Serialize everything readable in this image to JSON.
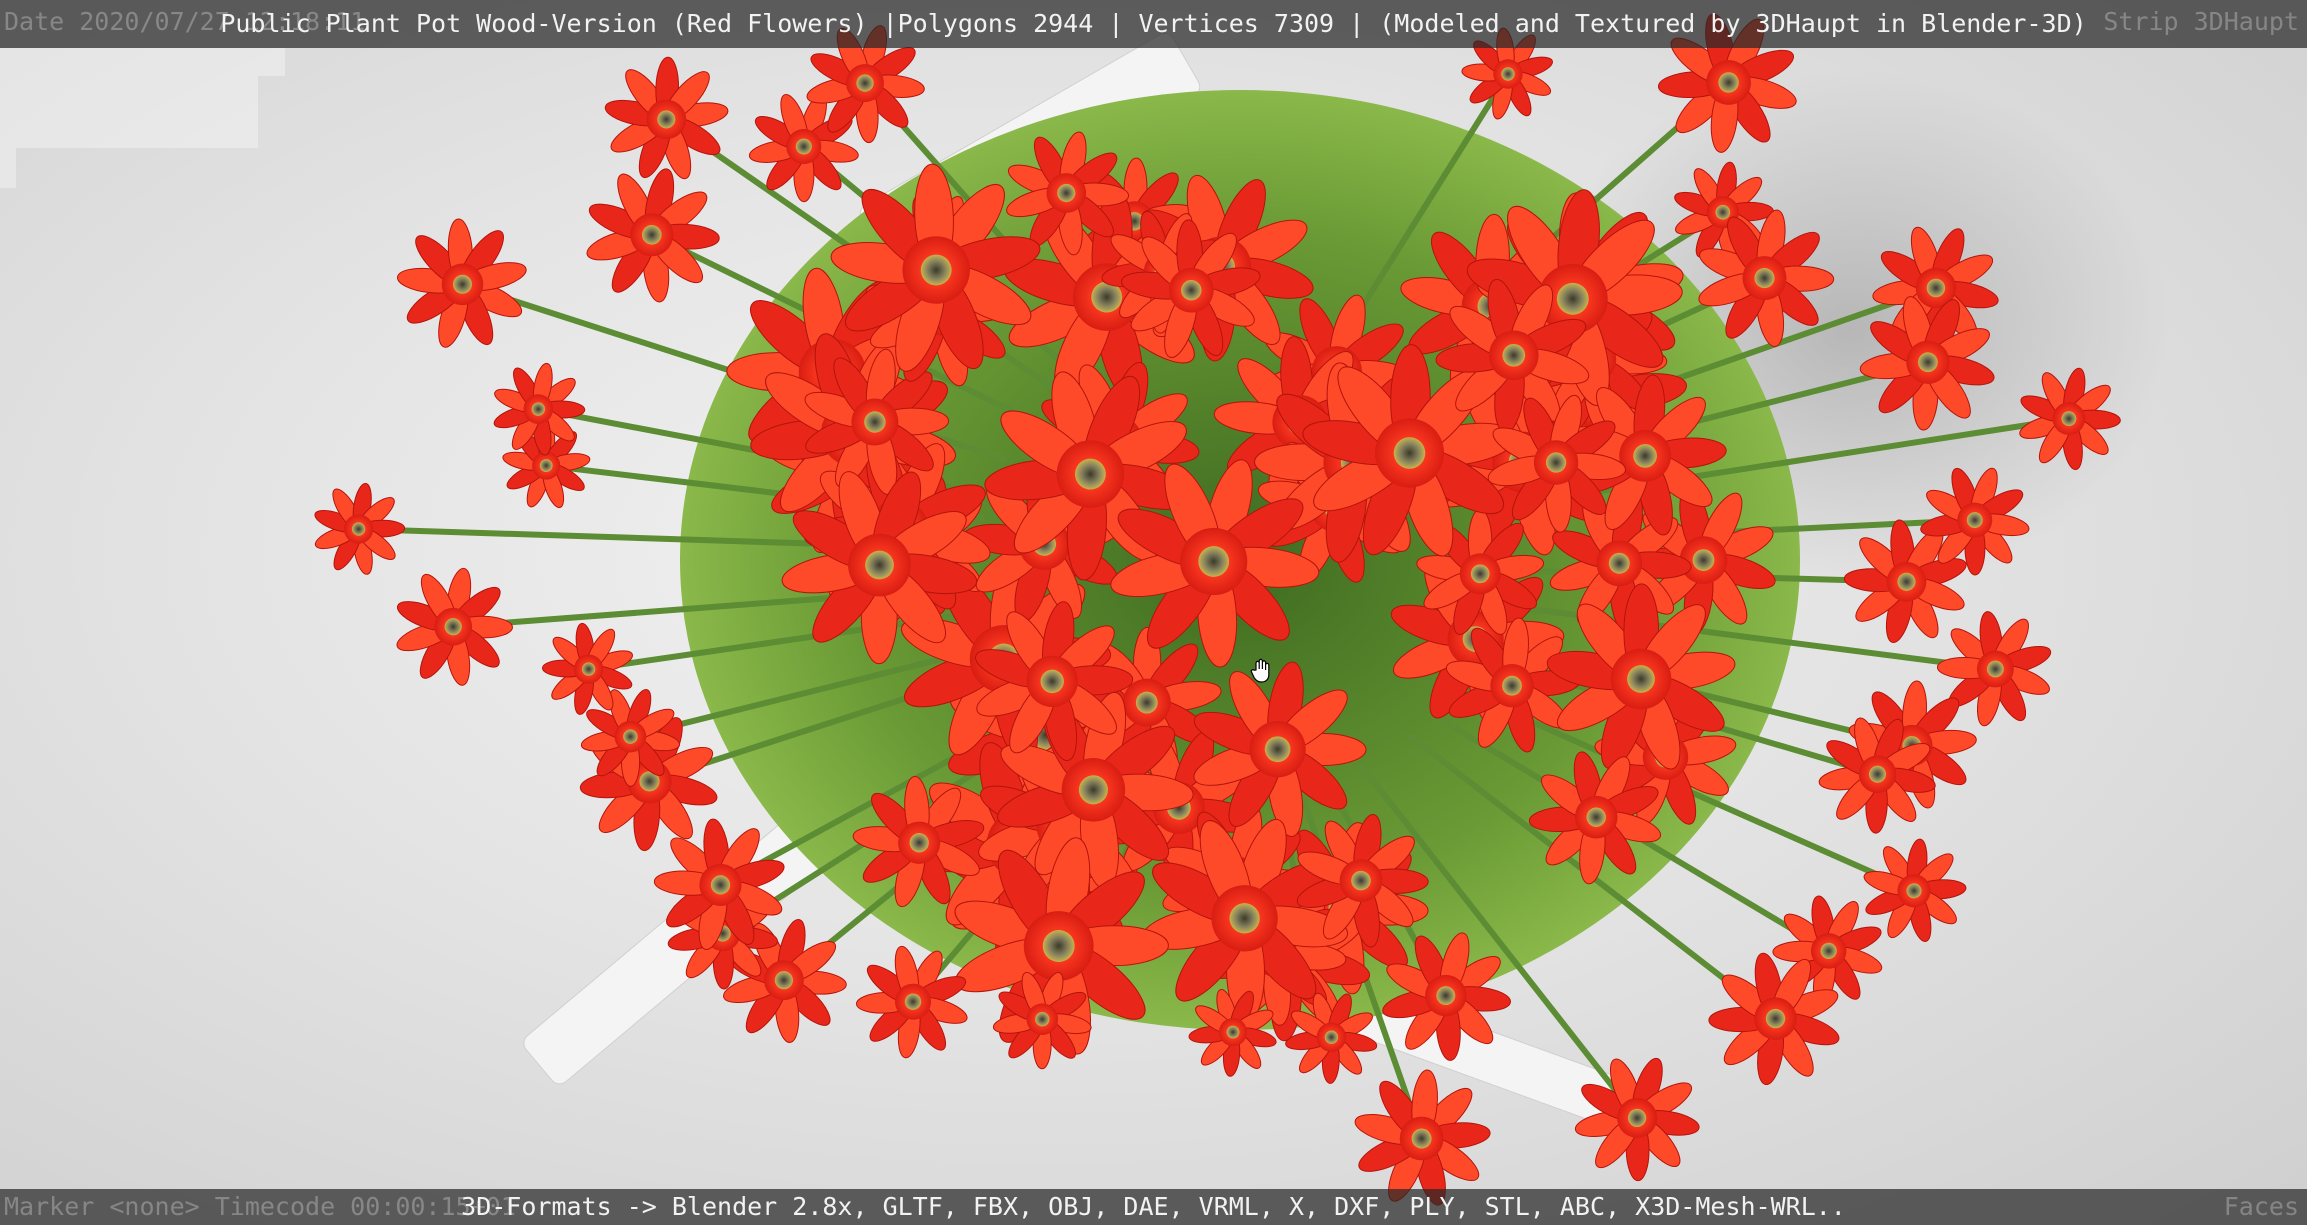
{
  "viewer": {
    "title": "Public Plant Pot Wood-Version (Red Flowers) |Polygons 2944 | Vertices 7309 | (Modeled and Textured by 3DHaupt in Blender-3D)",
    "formats": "3D-Formats -> Blender 2.8x, GLTF, FBX, OBJ, DAE, VRML, X, DXF, PLY, STL, ABC, X3D-Mesh-WRL..",
    "overlay_date": "Date 2020/07/27 12:18:11",
    "overlay_strip": "Strip 3DHaupt",
    "overlay_marker": "Marker <none>  Timecode 00:00:15+01",
    "overlay_faces": "Faces"
  },
  "colors": {
    "petal": "#e8271a",
    "petal_dark": "#b3140c",
    "petal_light": "#ff4a2a",
    "center": "#6b6a4a",
    "stem": "#5c8c33",
    "foliage": "#4f7f2a",
    "pot": "#f4f4f4",
    "bar_bg": "#282828"
  },
  "icons": {
    "cursor": "hand-grab-icon"
  }
}
